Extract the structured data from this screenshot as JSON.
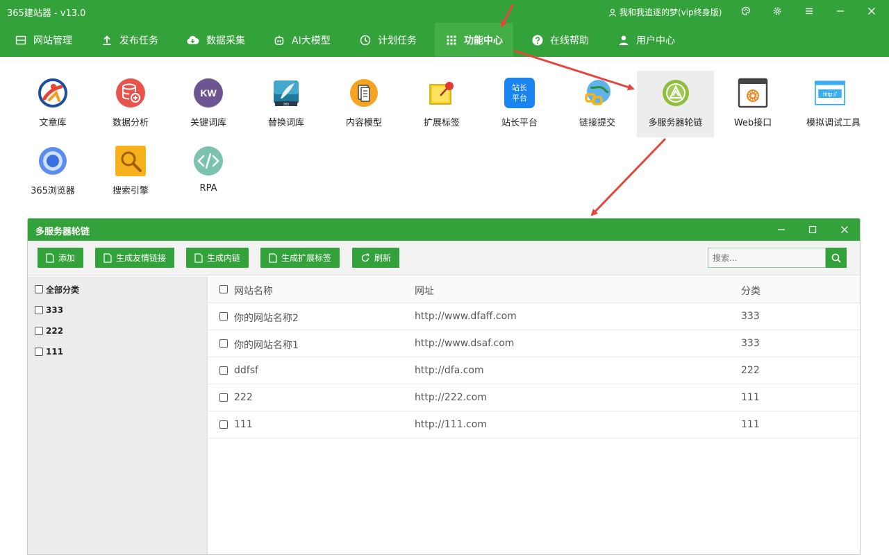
{
  "app": {
    "title": "365建站器 - v13.0",
    "user": "我和我追逐的梦(vip终身版)"
  },
  "nav": [
    {
      "label": "网站管理",
      "icon": "website-management-icon"
    },
    {
      "label": "发布任务",
      "icon": "upload-icon"
    },
    {
      "label": "数据采集",
      "icon": "cloud-download-icon"
    },
    {
      "label": "AI大模型",
      "icon": "robot-icon"
    },
    {
      "label": "计划任务",
      "icon": "clock-icon"
    },
    {
      "label": "功能中心",
      "icon": "grid-icon"
    },
    {
      "label": "在线帮助",
      "icon": "help-icon"
    },
    {
      "label": "用户中心",
      "icon": "user-icon"
    }
  ],
  "tools": [
    {
      "label": "文章库",
      "icon": "article-library-icon"
    },
    {
      "label": "数据分析",
      "icon": "data-analysis-icon"
    },
    {
      "label": "关键词库",
      "icon": "keyword-library-icon",
      "text": "KW"
    },
    {
      "label": "替换词库",
      "icon": "replace-library-icon"
    },
    {
      "label": "内容模型",
      "icon": "content-model-icon"
    },
    {
      "label": "扩展标签",
      "icon": "extension-tag-icon"
    },
    {
      "label": "站长平台",
      "icon": "webmaster-platform-icon",
      "text1": "站长",
      "text2": "平台"
    },
    {
      "label": "链接提交",
      "icon": "link-submit-icon"
    },
    {
      "label": "多服务器轮链",
      "icon": "multi-server-link-icon"
    },
    {
      "label": "Web接口",
      "icon": "web-api-icon"
    },
    {
      "label": "模拟调试工具",
      "icon": "debug-tool-icon",
      "text": "http://"
    },
    {
      "label": "365浏览器",
      "icon": "browser-icon"
    },
    {
      "label": "搜索引擎",
      "icon": "search-engine-icon"
    },
    {
      "label": "RPA",
      "icon": "rpa-icon"
    }
  ],
  "subwindow": {
    "title": "多服务器轮链",
    "buttons": [
      "添加",
      "生成友情链接",
      "生成内链",
      "生成扩展标签",
      "刷新"
    ],
    "search_placeholder": "搜索...",
    "categories": [
      "全部分类",
      "333",
      "222",
      "111"
    ],
    "columns": [
      "网站名称",
      "网址",
      "分类"
    ],
    "rows": [
      [
        "你的网站名称2",
        "http://www.dfaff.com",
        "333"
      ],
      [
        "你的网站名称1",
        "http://www.dsaf.com",
        "333"
      ],
      [
        "ddfsf",
        "http://dfa.com",
        "222"
      ],
      [
        "222",
        "http://222.com",
        "111"
      ],
      [
        "111",
        "http://111.com",
        "111"
      ]
    ]
  },
  "colors": {
    "primary": "#34a23a",
    "arrow": "#e5463c"
  }
}
